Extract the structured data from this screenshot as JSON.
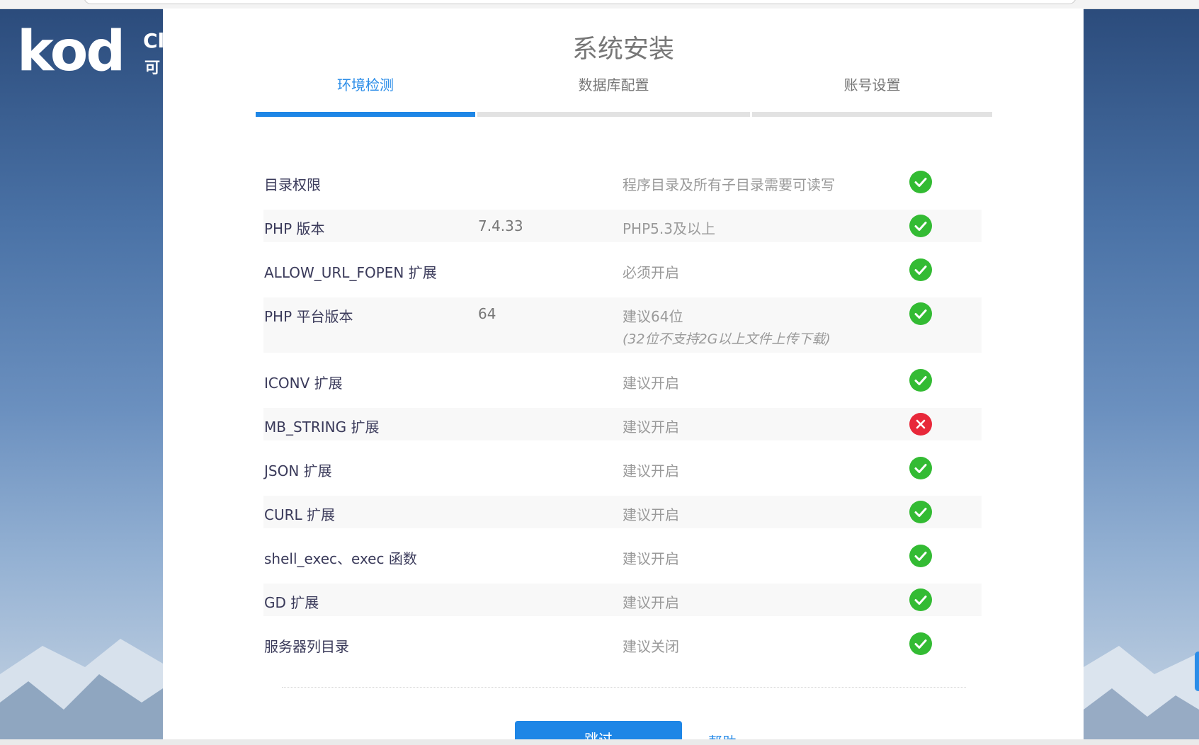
{
  "background": {
    "logo_word": "kod",
    "logo_suffix": "Cl",
    "logo_suffix_cn": "可"
  },
  "panel": {
    "title": "系统安装",
    "steps": [
      {
        "label": "环境检测",
        "active": true
      },
      {
        "label": "数据库配置",
        "active": false
      },
      {
        "label": "账号设置",
        "active": false
      }
    ]
  },
  "checks": [
    {
      "name": "目录权限",
      "value": "",
      "desc": "程序目录及所有子目录需要可读写",
      "note": "",
      "status": "ok"
    },
    {
      "name": "PHP 版本",
      "value": "7.4.33",
      "desc": "PHP5.3及以上",
      "note": "",
      "status": "ok"
    },
    {
      "name": "ALLOW_URL_FOPEN 扩展",
      "value": "",
      "desc": "必须开启",
      "note": "",
      "status": "ok"
    },
    {
      "name": "PHP 平台版本",
      "value": "64",
      "desc": "建议64位",
      "note": "(32位不支持2G以上文件上传下载)",
      "status": "ok"
    },
    {
      "name": "ICONV 扩展",
      "value": "",
      "desc": "建议开启",
      "note": "",
      "status": "ok"
    },
    {
      "name": "MB_STRING 扩展",
      "value": "",
      "desc": "建议开启",
      "note": "",
      "status": "fail"
    },
    {
      "name": "JSON 扩展",
      "value": "",
      "desc": "建议开启",
      "note": "",
      "status": "ok"
    },
    {
      "name": "CURL 扩展",
      "value": "",
      "desc": "建议开启",
      "note": "",
      "status": "ok"
    },
    {
      "name": "shell_exec、exec 函数",
      "value": "",
      "desc": "建议开启",
      "note": "",
      "status": "ok"
    },
    {
      "name": "GD 扩展",
      "value": "",
      "desc": "建议开启",
      "note": "",
      "status": "ok"
    },
    {
      "name": "服务器列目录",
      "value": "",
      "desc": "建议关闭",
      "note": "",
      "status": "ok"
    }
  ],
  "actions": {
    "skip_label": "跳过",
    "help_label": "帮助"
  },
  "icons": {
    "ok": "check-circle-icon",
    "fail": "x-circle-icon"
  },
  "colors": {
    "accent": "#1e86e6",
    "ok": "#33bb33",
    "fail": "#e8283a"
  }
}
